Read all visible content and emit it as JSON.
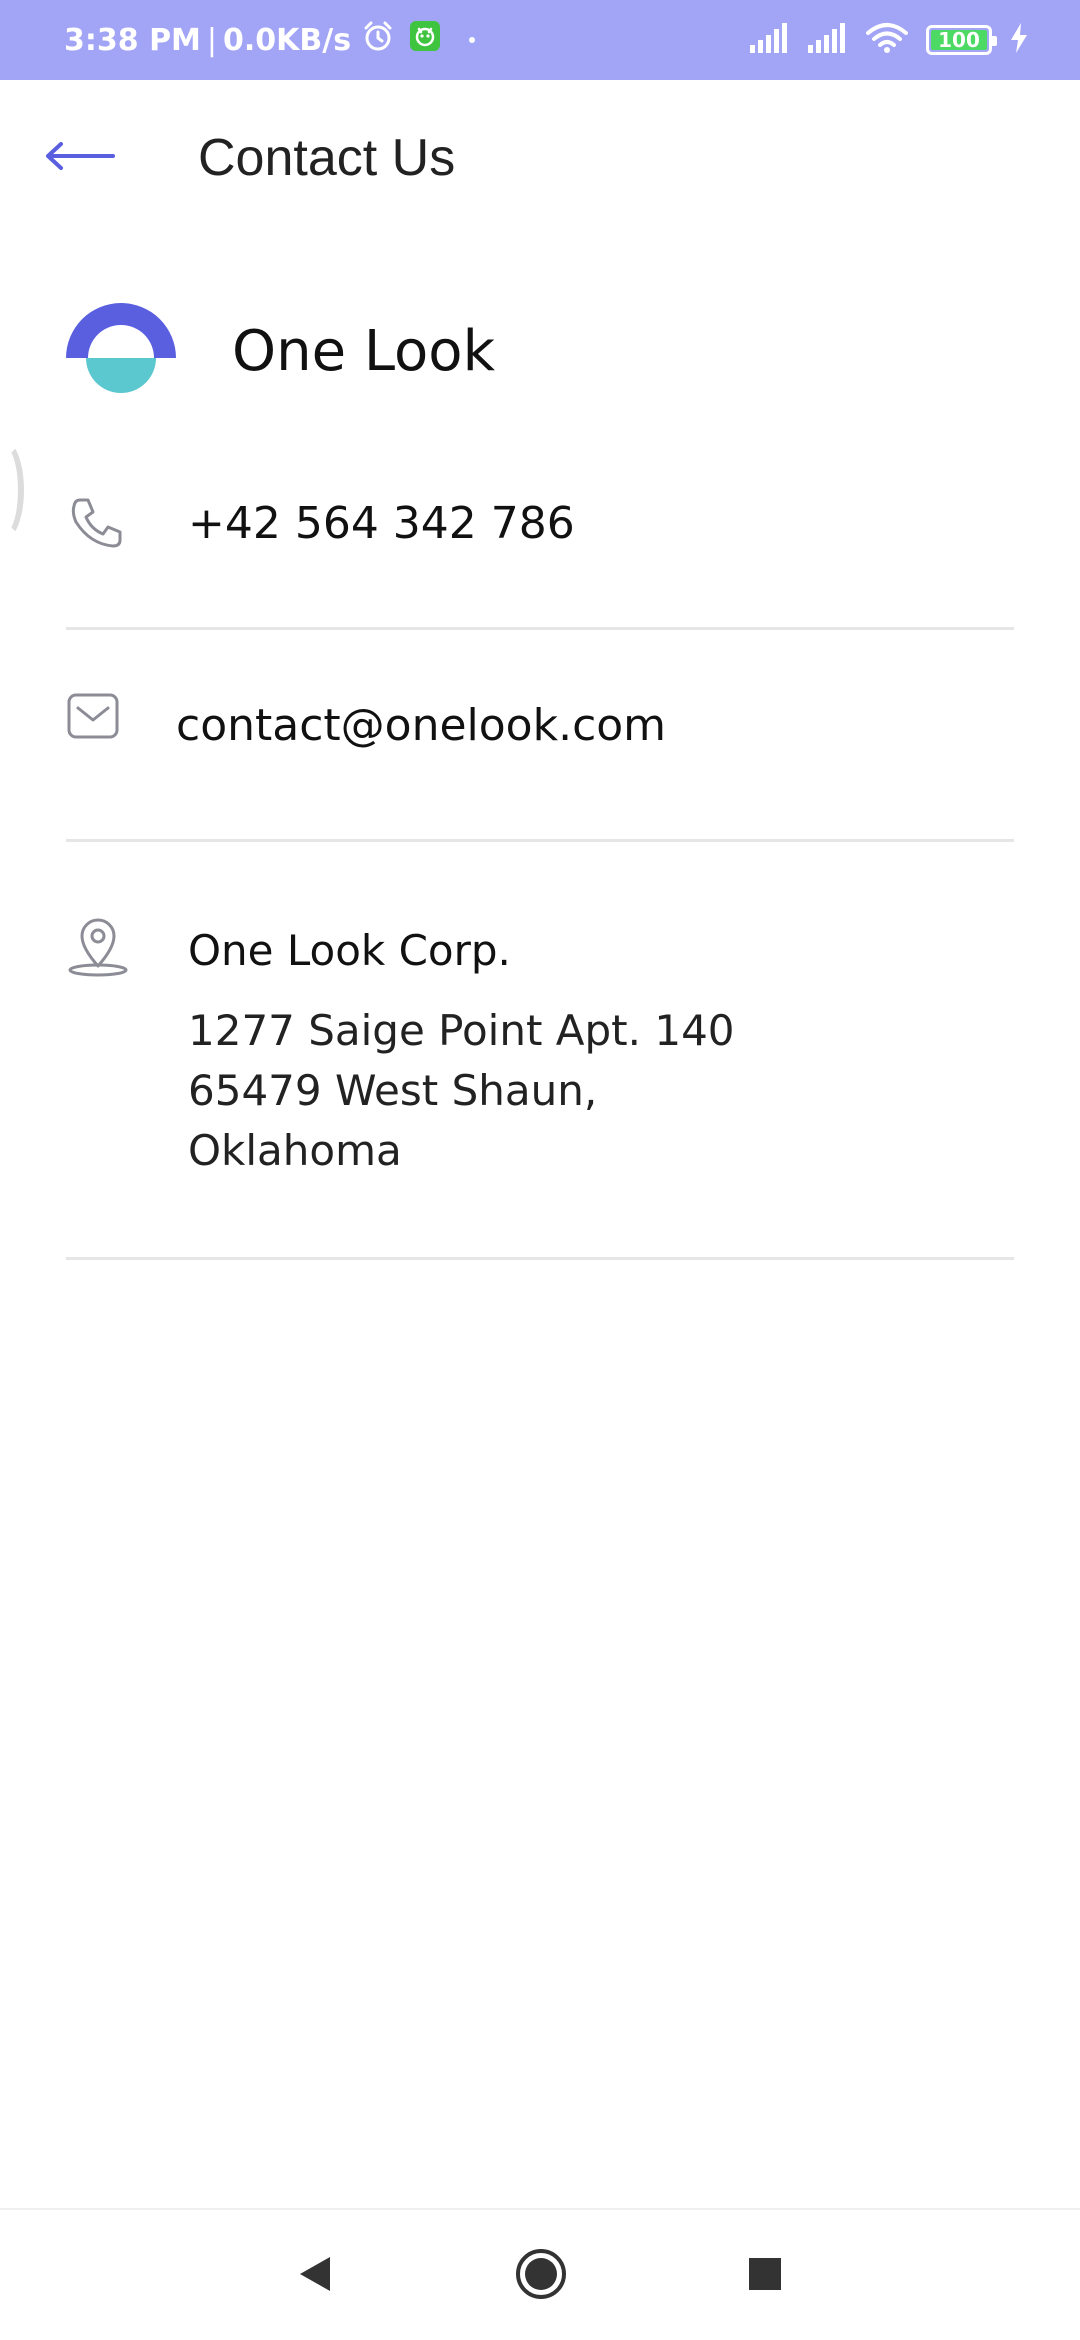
{
  "status_bar": {
    "time": "3:38 PM",
    "separator": "|",
    "network_speed": "0.0KB/s",
    "battery_level": "100",
    "battery_fraction": 1.0,
    "battery_color": "#4cd964",
    "background": "#a2a4f6",
    "icons": [
      "alarm-icon",
      "app-notification-icon",
      "cellular-signal-icon",
      "cellular-signal-icon",
      "wifi-icon",
      "battery-icon",
      "charging-bolt-icon"
    ]
  },
  "app_bar": {
    "title": "Contact Us",
    "back_icon": "arrow-left-icon",
    "accent_color": "#5a5fe0"
  },
  "brand": {
    "name": "One Look",
    "logo_colors": {
      "top": "#5a5fe0",
      "bottom": "#5bc8cf"
    }
  },
  "contact": {
    "phone": "+42 564 342 786",
    "email": "contact@onelook.com",
    "address": {
      "company": "One Look Corp.",
      "line1": "1277 Saige Point Apt. 140",
      "line2": "65479 West Shaun,",
      "line3": "Oklahoma"
    },
    "icons": {
      "phone": "phone-icon",
      "email": "mail-icon",
      "address": "location-pin-icon"
    }
  },
  "nav_bar": {
    "buttons": [
      "back-triangle-icon",
      "home-circle-icon",
      "recents-square-icon"
    ]
  }
}
